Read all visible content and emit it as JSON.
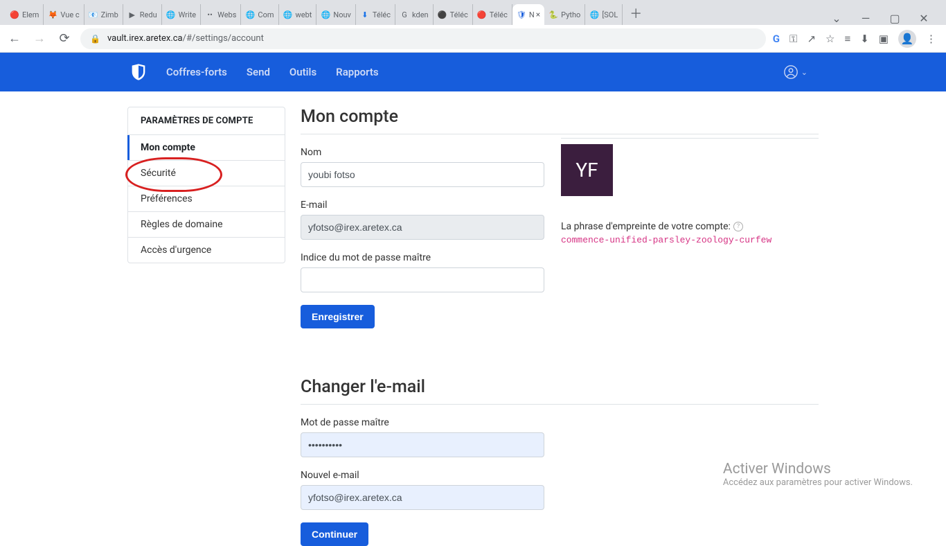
{
  "browser": {
    "tabs": [
      {
        "label": "Elem",
        "icon": "🔴"
      },
      {
        "label": "Vue c",
        "icon": "🦊"
      },
      {
        "label": "Zimb",
        "icon": "📧"
      },
      {
        "label": "Redu",
        "icon": "▶"
      },
      {
        "label": "Write",
        "icon": "🌐"
      },
      {
        "label": "Webs",
        "icon": "••"
      },
      {
        "label": "Com",
        "icon": "🌐"
      },
      {
        "label": "webt",
        "icon": "🌐"
      },
      {
        "label": "Nouv",
        "icon": "🌐"
      },
      {
        "label": "Téléc",
        "icon": "⬇"
      },
      {
        "label": "kden",
        "icon": "G"
      },
      {
        "label": "Téléc",
        "icon": "⚫"
      },
      {
        "label": "Téléc",
        "icon": "🔴"
      },
      {
        "label": "N",
        "icon": "🛡",
        "active": true,
        "close": "×"
      },
      {
        "label": "Pytho",
        "icon": "🐍"
      },
      {
        "label": "[SOL",
        "icon": "🌐"
      }
    ],
    "add": "＋",
    "window": {
      "chevron": "⌄",
      "min": "—",
      "max": "▢",
      "close": "✕"
    },
    "nav": {
      "back": "←",
      "fwd": "→",
      "reload": "⟳"
    },
    "url_host": "vault.irex.aretex.ca",
    "url_rest": "/#/settings/account",
    "icons": {
      "g": "G",
      "key": "⚿",
      "share": "↗",
      "star": "☆",
      "playlist": "≡",
      "down": "⬇",
      "panel": "▣",
      "profile": "👤",
      "menu": "⋮"
    }
  },
  "nav": {
    "links": [
      "Coffres-forts",
      "Send",
      "Outils",
      "Rapports"
    ]
  },
  "sidebar": {
    "header": "PARAMÈTRES DE COMPTE",
    "items": [
      {
        "label": "Mon compte"
      },
      {
        "label": "Sécurité"
      },
      {
        "label": "Préférences"
      },
      {
        "label": "Règles de domaine"
      },
      {
        "label": "Accès d'urgence"
      }
    ]
  },
  "account": {
    "heading": "Mon compte",
    "name_label": "Nom",
    "name_value": "youbi fotso",
    "email_label": "E-mail",
    "email_value": "yfotso@irex.aretex.ca",
    "hint_label": "Indice du mot de passe maître",
    "save_label": "Enregistrer",
    "avatar_initials": "YF",
    "fingerprint_label": "La phrase d'empreinte de votre compte:",
    "fingerprint_value": "commence-unified-parsley-zoology-curfew"
  },
  "change_email": {
    "heading": "Changer l'e-mail",
    "master_label": "Mot de passe maître",
    "master_value": "••••••••••",
    "new_email_label": "Nouvel e-mail",
    "new_email_value": "yfotso@irex.aretex.ca",
    "continue_label": "Continuer"
  },
  "watermark": {
    "title": "Activer Windows",
    "sub": "Accédez aux paramètres pour activer Windows."
  }
}
